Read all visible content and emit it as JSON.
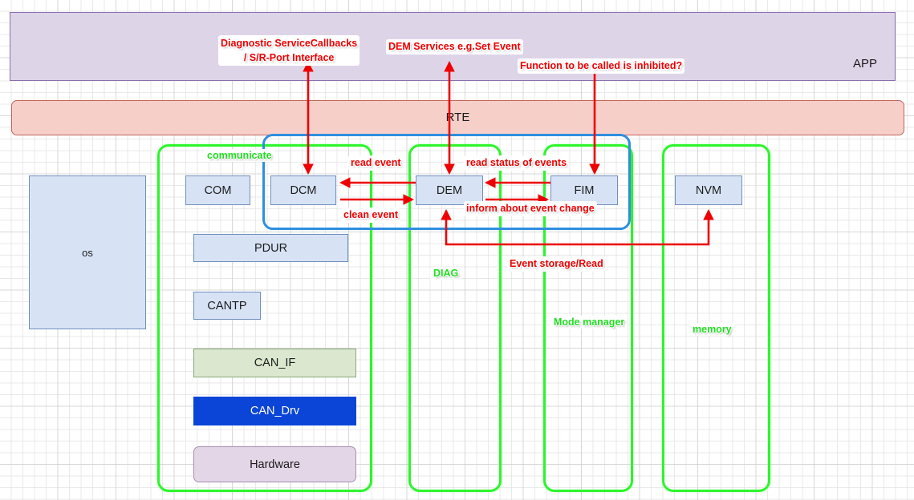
{
  "diagram": {
    "title": "AUTOSAR Diagnostic Architecture",
    "colors": {
      "app_fill": "#ded4e8",
      "rte_fill": "#f7cfc9",
      "module_fill": "#d7e3f5",
      "canif_fill": "#dbe8cf",
      "candrv_fill": "#0a45d8",
      "hardware_fill": "#e3d6e6",
      "group_green": "#2df52d",
      "group_blue": "#2f8fe0",
      "arrow_red": "#ee0000",
      "label_red": "#ee0000",
      "label_green": "#22dd22"
    }
  },
  "layers": {
    "app_label": "APP",
    "rte_label": "RTE"
  },
  "modules": {
    "os": "os",
    "com": "COM",
    "dcm": "DCM",
    "dem": "DEM",
    "fim": "FIM",
    "nvm": "NVM",
    "pdur": "PDUR",
    "cantp": "CANTP",
    "can_if": "CAN_IF",
    "can_drv": "CAN_Drv",
    "hardware": "Hardware"
  },
  "group_labels": {
    "communicate": "communicate",
    "diag": "DIAG",
    "mode_manager": "Mode manager",
    "memory": "memory"
  },
  "annotations": {
    "diagnostic_service_line1": "Diagnostic ServiceCallbacks",
    "diagnostic_service_line2": "/ S/R-Port Interface",
    "dem_services": "DEM Services e.g.Set Event",
    "function_inhibited": "Function to be called is inhibited?",
    "read_event": "read event",
    "clean_event": "clean event",
    "read_status_of_events": "read status of events",
    "inform_about_event_change": "inform about  event change",
    "event_storage_read": "Event storage/Read"
  }
}
